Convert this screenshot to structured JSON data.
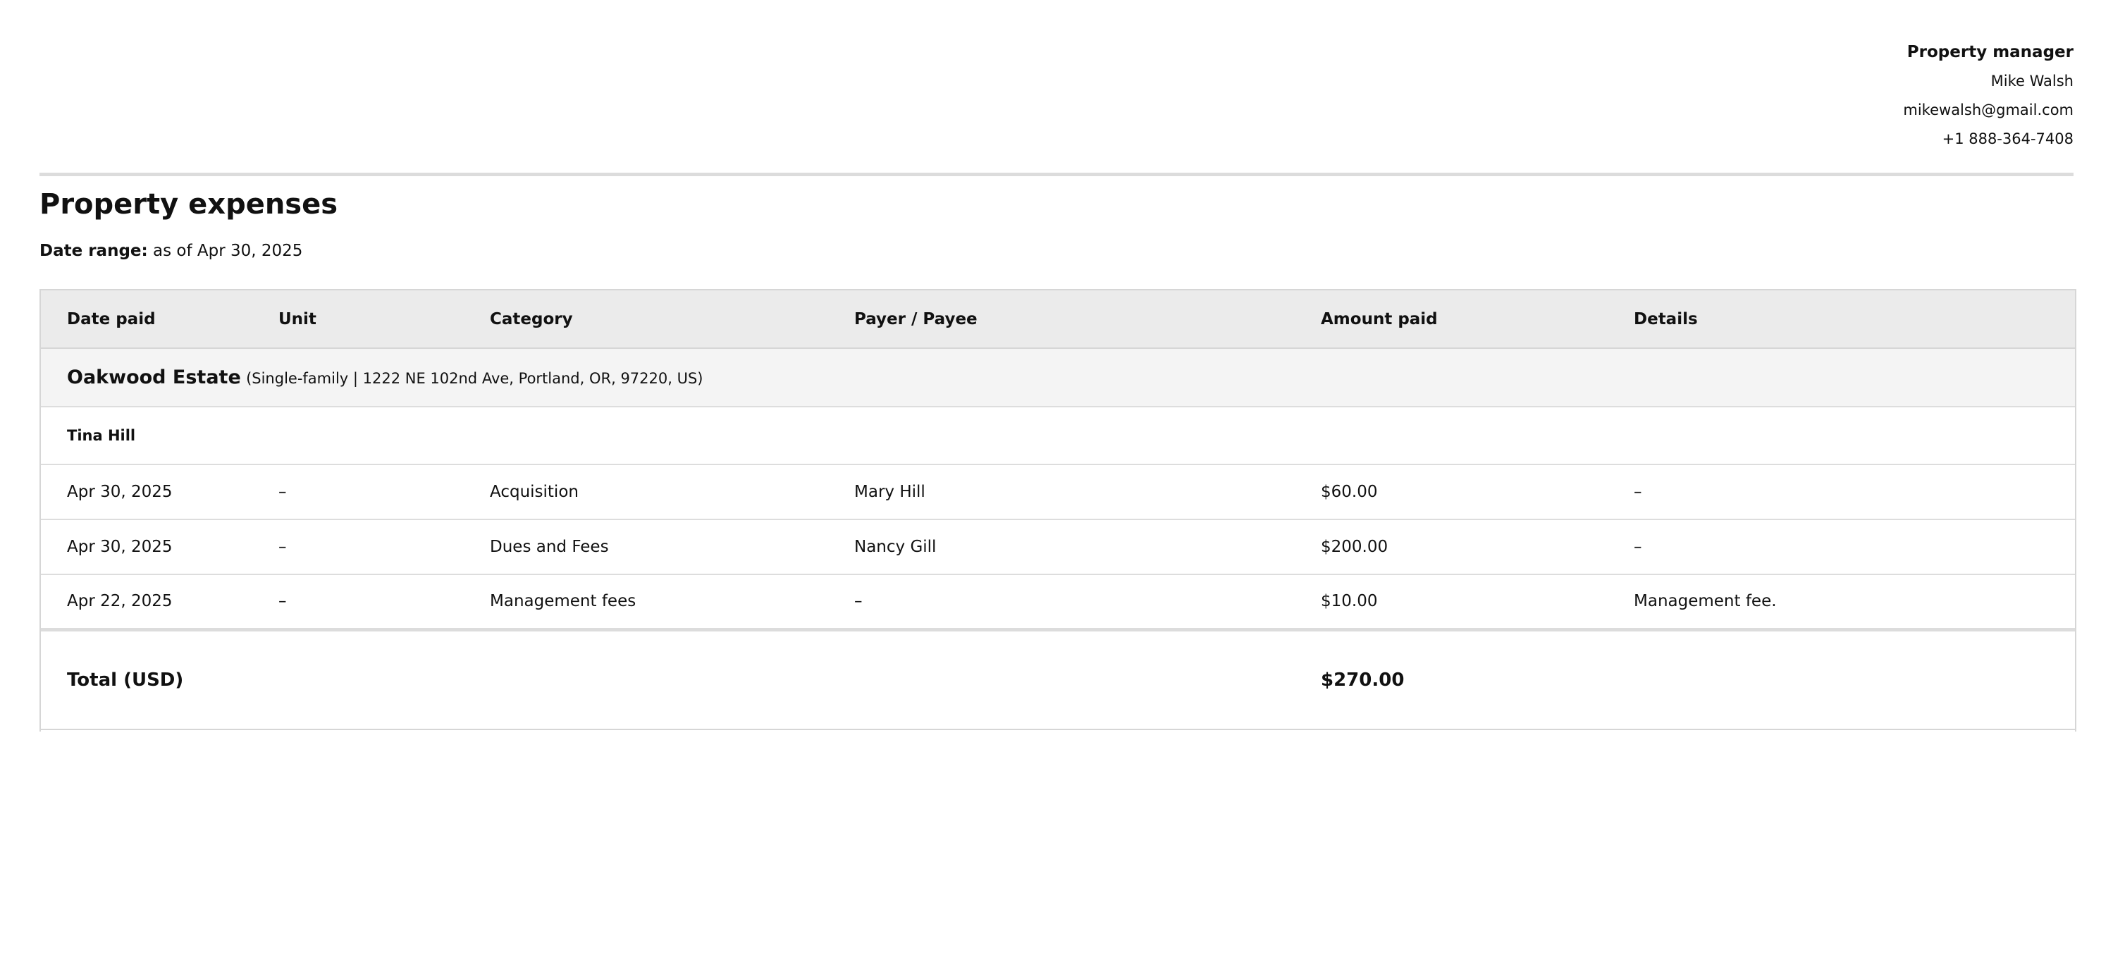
{
  "manager": {
    "title": "Property manager",
    "name": "Mike Walsh",
    "email": "mikewalsh@gmail.com",
    "phone": "+1 888-364-7408"
  },
  "report": {
    "title": "Property expenses",
    "date_range_label": "Date range:",
    "date_range_value": "as of Apr 30, 2025"
  },
  "table": {
    "columns": [
      "Date paid",
      "Unit",
      "Category",
      "Payer / Payee",
      "Amount paid",
      "Details"
    ],
    "property": {
      "name": "Oakwood Estate",
      "meta": "(Single-family | 1222 NE 102nd Ave, Portland, OR, 97220, US)"
    },
    "tenant": "Tina Hill",
    "rows": [
      {
        "date": "Apr 30, 2025",
        "unit": "–",
        "category": "Acquisition",
        "payee": "Mary Hill",
        "amount": "$60.00",
        "details": "–"
      },
      {
        "date": "Apr 30, 2025",
        "unit": "–",
        "category": "Dues and Fees",
        "payee": "Nancy Gill",
        "amount": "$200.00",
        "details": "–"
      },
      {
        "date": "Apr 22, 2025",
        "unit": "–",
        "category": "Management fees",
        "payee": "–",
        "amount": "$10.00",
        "details": "Management fee."
      }
    ],
    "total_label": "Total (USD)",
    "total_amount": "$270.00"
  }
}
